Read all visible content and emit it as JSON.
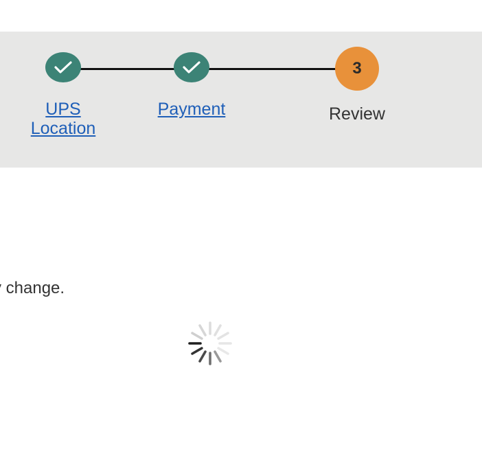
{
  "stepper": {
    "steps": [
      {
        "label": "UPS Location",
        "state": "completed",
        "icon": "checkmark-icon"
      },
      {
        "label": "Payment",
        "state": "completed",
        "icon": "checkmark-icon"
      },
      {
        "label": "Review",
        "state": "current",
        "number": "3"
      }
    ],
    "colors": {
      "completed": "#3c8376",
      "current": "#e8913a",
      "link": "#1f5fb8",
      "bar_background": "#e7e7e6"
    }
  },
  "main": {
    "notice_text": "y change."
  },
  "loading": {
    "icon": "loading-spinner-icon"
  }
}
